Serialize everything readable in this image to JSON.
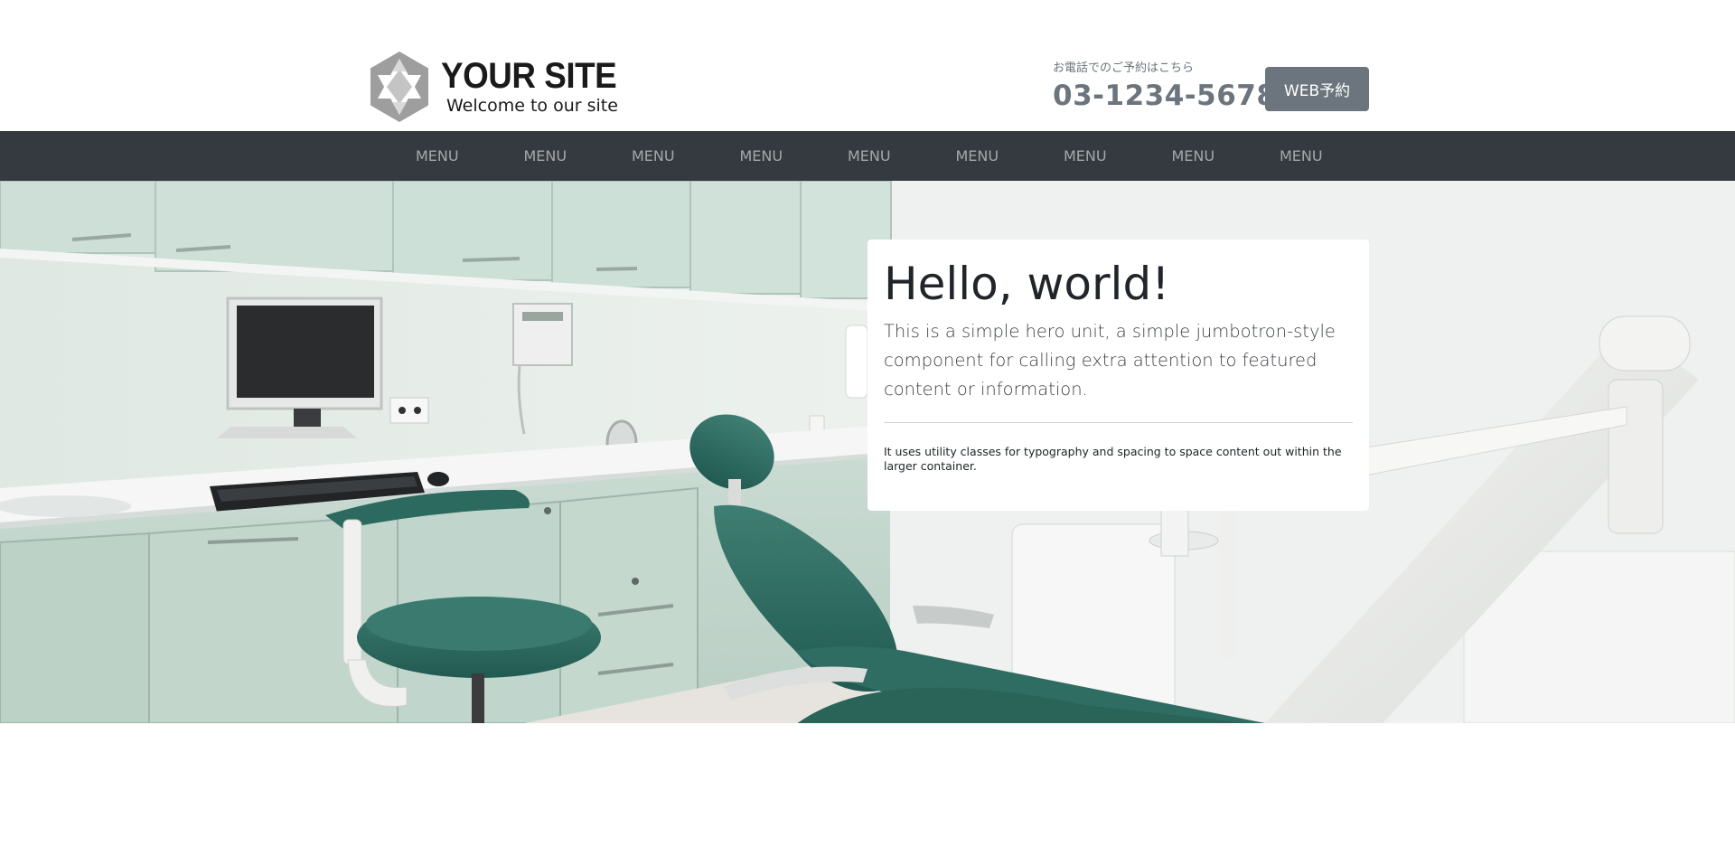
{
  "header": {
    "logo_title": "YOUR SITE",
    "logo_tagline": "Welcome to our site",
    "phone_caption": "お電話でのご予約はこちら",
    "phone_number": "03-1234-5678",
    "web_button_label": "WEB予約",
    "colors": {
      "muted": "#6c757d"
    }
  },
  "nav": {
    "background": "#343a40",
    "items": [
      {
        "label": "MENU"
      },
      {
        "label": "MENU"
      },
      {
        "label": "MENU"
      },
      {
        "label": "MENU"
      },
      {
        "label": "MENU"
      },
      {
        "label": "MENU"
      },
      {
        "label": "MENU"
      },
      {
        "label": "MENU"
      },
      {
        "label": "MENU"
      }
    ]
  },
  "hero": {
    "image": "dental-clinic-photo",
    "title": "Hello, world!",
    "lead": "This is a simple hero unit, a simple jumbotron-style component for calling extra attention to featured content or information.",
    "body": "It uses utility classes for typography and spacing to space content out within the larger container."
  }
}
